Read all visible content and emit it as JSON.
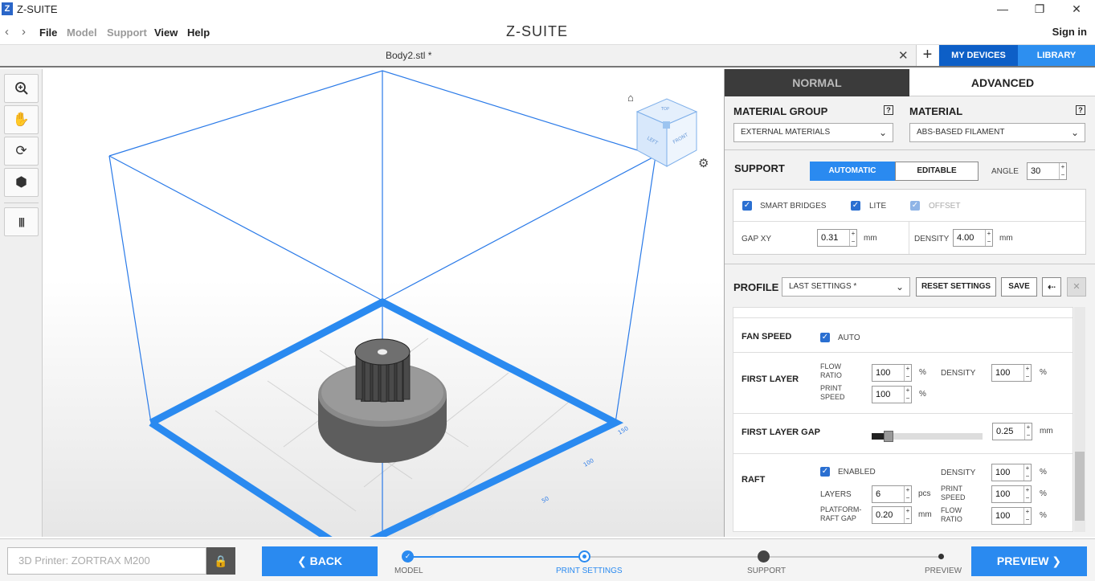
{
  "titlebar": {
    "app_logo": "Z",
    "title": "Z-SUITE",
    "minimize": "—",
    "maximize": "❐",
    "close": "✕"
  },
  "menubar": {
    "back_arrow": "‹",
    "forward_arrow": "›",
    "items": [
      {
        "label": "File",
        "enabled": true
      },
      {
        "label": "Model",
        "enabled": false
      },
      {
        "label": "Support",
        "enabled": false
      },
      {
        "label": "View",
        "enabled": true
      },
      {
        "label": "Help",
        "enabled": true
      }
    ],
    "brand": "Z-SUITE",
    "signin": "Sign in"
  },
  "tabbar": {
    "file_tab": "Body2.stl *",
    "close": "✕",
    "add": "+",
    "my_devices": "MY DEVICES",
    "library": "LIBRARY"
  },
  "left_tools": [
    {
      "icon": "zoom-icon",
      "glyph": "⊕"
    },
    {
      "icon": "pan-hand-icon",
      "glyph": "✋"
    },
    {
      "icon": "rotate-icon",
      "glyph": "⟳"
    },
    {
      "icon": "cube-icon",
      "glyph": "⬢"
    },
    {
      "icon": "layers-icon",
      "glyph": "|||"
    }
  ],
  "viewport": {
    "view_cube": {
      "left": "LEFT",
      "front": "FRONT",
      "top": "TOP"
    },
    "home_icon": "⌂",
    "settings_icon": "⚙",
    "axis_labels": [
      "150",
      "100",
      "50"
    ]
  },
  "panel": {
    "tabs": {
      "normal": "NORMAL",
      "advanced": "ADVANCED",
      "active": "advanced"
    },
    "material_group": {
      "label": "MATERIAL GROUP",
      "help": "?",
      "value": "EXTERNAL MATERIALS"
    },
    "material": {
      "label": "MATERIAL",
      "help": "?",
      "value": "ABS-BASED FILAMENT"
    },
    "support": {
      "label": "SUPPORT",
      "automatic": "AUTOMATIC",
      "editable": "EDITABLE",
      "angle_label": "ANGLE",
      "angle_value": "30",
      "smart_bridges": "SMART BRIDGES",
      "lite": "LITE",
      "offset": "OFFSET",
      "gap_xy_label": "GAP XY",
      "gap_xy_value": "0.31",
      "gap_unit": "mm",
      "density_label": "DENSITY",
      "density_value": "4.00",
      "density_unit": "mm"
    },
    "profile": {
      "label": "PROFILE",
      "value": "LAST SETTINGS *",
      "reset": "RESET SETTINGS",
      "save": "SAVE",
      "export_icon": "⇠",
      "delete_icon": "✕"
    },
    "fan_speed": {
      "label": "FAN SPEED",
      "auto": "AUTO"
    },
    "first_layer": {
      "label": "FIRST LAYER",
      "flow_ratio_label_1": "FLOW",
      "flow_ratio_label_2": "RATIO",
      "flow_ratio_value": "100",
      "print_speed_label_1": "PRINT",
      "print_speed_label_2": "SPEED",
      "print_speed_value": "100",
      "density_label": "DENSITY",
      "density_value": "100",
      "percent": "%"
    },
    "first_layer_gap": {
      "label": "FIRST LAYER GAP",
      "value": "0.25",
      "unit": "mm",
      "slider_level": 0.12
    },
    "raft": {
      "label": "RAFT",
      "enabled": "ENABLED",
      "layers_label": "LAYERS",
      "layers_value": "6",
      "layers_unit": "pcs",
      "platform_gap_label_1": "PLATFORM-",
      "platform_gap_label_2": "RAFT GAP",
      "platform_gap_value": "0.20",
      "platform_gap_unit": "mm",
      "density_label": "DENSITY",
      "density_value": "100",
      "print_speed_label_1": "PRINT",
      "print_speed_label_2": "SPEED",
      "print_speed_value": "100",
      "flow_ratio_label_1": "FLOW",
      "flow_ratio_label_2": "RATIO",
      "flow_ratio_value": "100",
      "percent": "%"
    }
  },
  "bottombar": {
    "printer_placeholder": "3D Printer: ZORTRAX M200",
    "lock_icon": "🔒",
    "back": "❮  BACK",
    "preview": "PREVIEW  ❯",
    "steps": [
      {
        "label": "MODEL",
        "state": "done"
      },
      {
        "label": "PRINT SETTINGS",
        "state": "current"
      },
      {
        "label": "SUPPORT",
        "state": "locked"
      },
      {
        "label": "PREVIEW",
        "state": "pending"
      }
    ]
  },
  "colors": {
    "accent": "#2a8af0",
    "dark_accent": "#0d5fc7",
    "box_blue": "#1a7ae8",
    "model_gray": "#6b6b6b"
  }
}
